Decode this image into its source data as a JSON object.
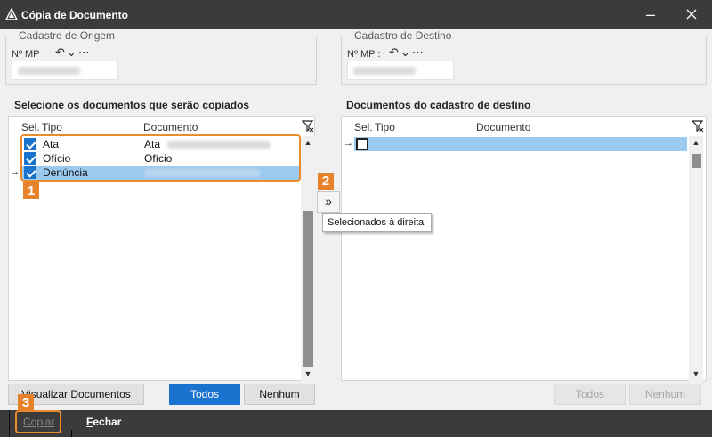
{
  "window": {
    "title": "Cópia de Documento"
  },
  "origin": {
    "legend": "Cadastro de Origem",
    "mp_label": "Nº MP"
  },
  "destination": {
    "legend": "Cadastro de Destino",
    "mp_label": "Nº MP :"
  },
  "left_panel": {
    "title": "Selecione os documentos que serão copiados",
    "columns": {
      "sel": "Sel.",
      "tipo": "Tipo",
      "documento": "Documento"
    },
    "rows": [
      {
        "checked": true,
        "tipo": "Ata",
        "documento": "Ata"
      },
      {
        "checked": true,
        "tipo": "Ofício",
        "documento": "Ofício"
      },
      {
        "checked": true,
        "tipo": "Denúncia",
        "documento": ""
      }
    ]
  },
  "right_panel": {
    "title": "Documentos do cadastro de destino",
    "columns": {
      "sel": "Sel.",
      "tipo": "Tipo",
      "documento": "Documento"
    }
  },
  "buttons": {
    "view_docs": "Visualizar Documentos",
    "all_left": "Todos",
    "none_left": "Nenhum",
    "all_right": "Todos",
    "none_right": "Nenhum",
    "move_right_tooltip": "Selecionados à direita"
  },
  "footer": {
    "copy": "Copiar",
    "close_first": "F",
    "close_rest": "echar"
  },
  "steps": {
    "s1": "1",
    "s2": "2",
    "s3": "3"
  },
  "colors": {
    "accent": "#1a73cf",
    "highlight": "#ec8b2e",
    "titlebar": "#3b3b3b",
    "selected_row": "#9cc9ee"
  }
}
